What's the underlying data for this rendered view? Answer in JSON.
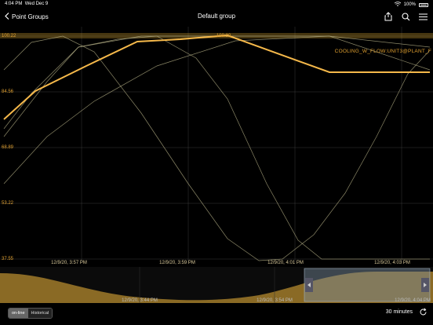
{
  "status_bar": {
    "time": "4:04 PM",
    "date": "Wed Dec 9",
    "battery": "100%"
  },
  "nav": {
    "back_label": "Point Groups",
    "title": "Default group"
  },
  "icons": {
    "share": "share-icon",
    "search": "search-icon",
    "menu": "menu-icon",
    "back": "chevron-left-icon",
    "refresh": "refresh-icon",
    "wifi": "wifi-icon",
    "battery": "battery-icon"
  },
  "chart_data": {
    "type": "line",
    "series_label": "COOLING_W_FLOW:UNIT3@PLANT_F",
    "highlight_value": "100.22",
    "y_ticks": [
      "100.22",
      "84.56",
      "68.89",
      "53.22",
      "37.55"
    ],
    "x_ticks": [
      "12/9/20, 3:57 PM",
      "12/9/20, 3:59 PM",
      "12/9/20, 4:01 PM",
      "12/9/20, 4:03 PM"
    ],
    "ylim": [
      37.55,
      100.22
    ],
    "grid": true,
    "colors": {
      "highlight": "#f5b84a",
      "thin": "#b9b48a",
      "axis_label": "#e0a030"
    }
  },
  "overview": {
    "x_ticks": [
      "12/9/20, 3:44 PM",
      "12/9/20, 3:54 PM",
      "12/9/20, 4:04 PM"
    ],
    "fill_color": "#8a6a25"
  },
  "controls": {
    "modes": [
      "on-line",
      "Historical"
    ],
    "active_mode": "on-line",
    "duration": "30 minutes"
  }
}
